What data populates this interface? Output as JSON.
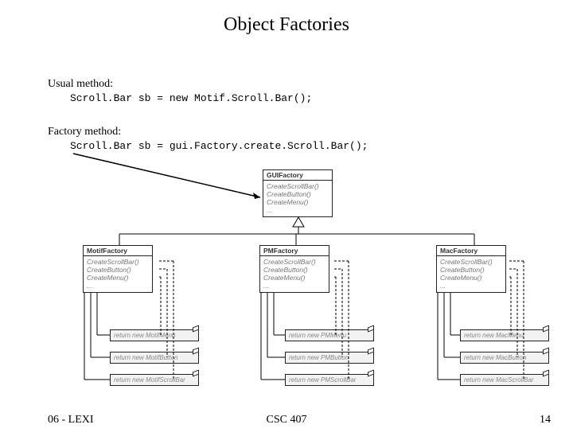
{
  "title": "Object Factories",
  "usual": {
    "label": "Usual method:",
    "code": "Scroll.Bar sb = new Motif.Scroll.Bar();"
  },
  "factory": {
    "label": "Factory method:",
    "code": "Scroll.Bar sb = gui.Factory.create.Scroll.Bar();"
  },
  "uml": {
    "parent": {
      "name": "GUIFactory",
      "ops": "CreateScrollBar()\nCreateButton()\nCreateMenu()\n..."
    },
    "motif": {
      "name": "MotifFactory",
      "ops": "CreateScrollBar()\nCreateButton()\nCreateMenu()\n..."
    },
    "pm": {
      "name": "PMFactory",
      "ops": "CreateScrollBar()\nCreateButton()\nCreateMenu()\n..."
    },
    "mac": {
      "name": "MacFactory",
      "ops": "CreateScrollBar()\nCreateButton()\nCreateMenu()\n..."
    }
  },
  "returns": {
    "motif": {
      "menu": "return new MotifMenu",
      "button": "return new MotifButton",
      "scrollbar": "return new MotifScrollBar"
    },
    "pm": {
      "menu": "return new PMMenu",
      "button": "return new PMButton",
      "scrollbar": "return new PMScrollBar"
    },
    "mac": {
      "menu": "return new MacMenu",
      "button": "return new MacButton",
      "scrollbar": "return new MacScrollBar"
    }
  },
  "footer": {
    "left": "06 - LEXI",
    "center": "CSC 407",
    "page": "14"
  }
}
